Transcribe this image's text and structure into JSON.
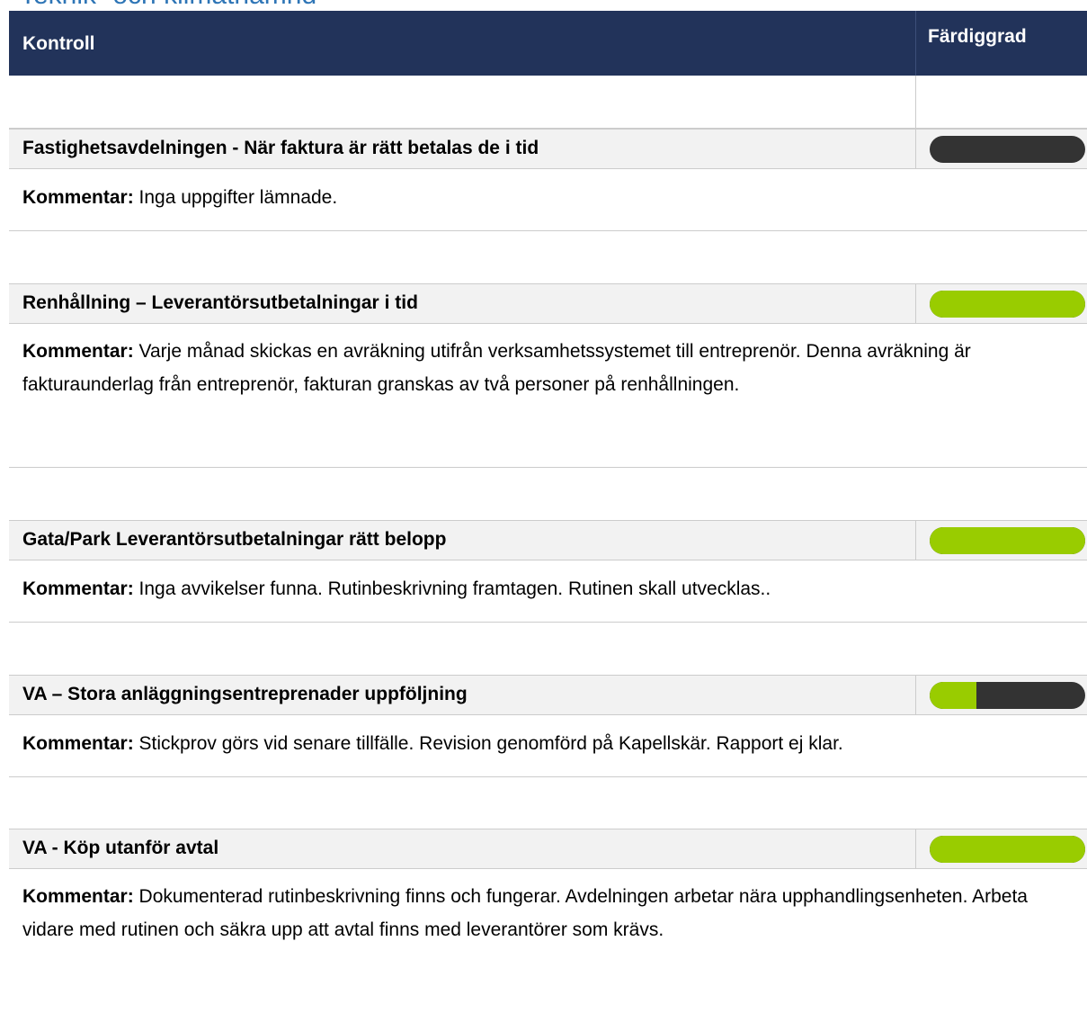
{
  "page_title": "Teknik- och klimatnämnd",
  "header": {
    "control_label": "Kontroll",
    "completion_label": "Färdiggrad"
  },
  "comment_label": "Kommentar:",
  "colors": {
    "header_bg": "#22335a",
    "progress_done": "#99cc00",
    "progress_remaining": "#333333",
    "title": "#2e75b6"
  },
  "controls": [
    {
      "title": "Fastighetsavdelningen - När faktura är rätt betalas de i tid",
      "progress": 0.0,
      "comment": "Inga uppgifter lämnade."
    },
    {
      "title": "Renhållning – Leverantörsutbetalningar i tid",
      "progress": 1.0,
      "comment": "Varje månad skickas en avräkning utifrån verksamhetssystemet till entreprenör. Denna avräkning är fakturaunderlag från entreprenör, fakturan granskas av två personer på renhållningen."
    },
    {
      "title": "Gata/Park Leverantörsutbetalningar rätt belopp",
      "progress": 1.0,
      "comment": "Inga avvikelser funna. Rutinbeskrivning framtagen. Rutinen skall utvecklas.."
    },
    {
      "title": "VA – Stora anläggningsentreprenader uppföljning",
      "progress": 0.3,
      "comment": "Stickprov görs vid senare tillfälle. Revision genomförd på Kapellskär. Rapport ej klar."
    },
    {
      "title": "VA - Köp utanför avtal",
      "progress": 1.0,
      "comment": "Dokumenterad rutinbeskrivning finns och fungerar. Avdelningen arbetar nära upphandlingsenheten. Arbeta vidare med rutinen och säkra upp att avtal finns med leverantörer som krävs."
    }
  ]
}
